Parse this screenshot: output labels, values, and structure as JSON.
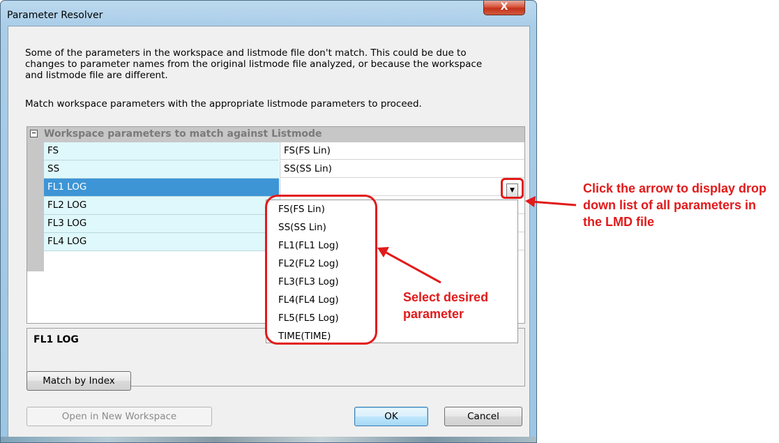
{
  "window": {
    "title": "Parameter Resolver",
    "close_glyph": "X"
  },
  "intro": {
    "text": "Some of the parameters in the workspace and listmode file don't match. This could be due to\nchanges to parameter names from the original listmode file analyzed, or because the workspace\nand listmode file are different.",
    "instruction": "Match workspace parameters with the appropriate listmode parameters to proceed."
  },
  "grid": {
    "toggle_glyph": "−",
    "header": "Workspace parameters to match against Listmode",
    "rows": [
      {
        "name": "FS",
        "value": "FS(FS Lin)"
      },
      {
        "name": "SS",
        "value": "SS(SS Lin)"
      },
      {
        "name": "FL1 LOG",
        "value": ""
      },
      {
        "name": "FL2 LOG",
        "value": ""
      },
      {
        "name": "FL3 LOG",
        "value": ""
      },
      {
        "name": "FL4 LOG",
        "value": ""
      }
    ],
    "selected_row": "FL1 LOG",
    "dropdown_arrow_icon": "dropdown-arrow-icon"
  },
  "description": {
    "title": "FL1 LOG"
  },
  "dropdown": {
    "items": [
      "FS(FS Lin)",
      "SS(SS Lin)",
      "FL1(FL1 Log)",
      "FL2(FL2 Log)",
      "FL3(FL3 Log)",
      "FL4(FL4 Log)",
      "FL5(FL5 Log)",
      "TIME(TIME)"
    ]
  },
  "buttons": {
    "match_by_index": "Match by Index",
    "open_new_workspace": "Open in New Workspace",
    "ok": "OK",
    "cancel": "Cancel"
  },
  "annotations": {
    "arrow_note": "Click the arrow to display drop\ndown list of all parameters in\nthe LMD file",
    "select_note": "Select desired\nparameter",
    "color": "#e21a1a"
  }
}
